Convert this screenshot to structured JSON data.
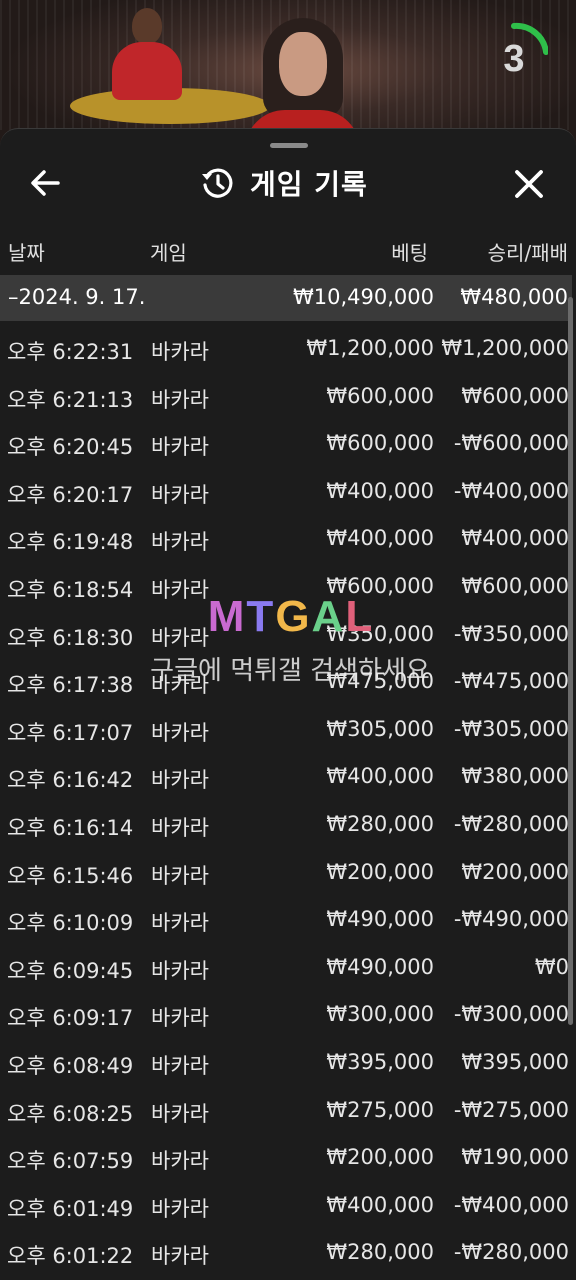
{
  "timer": {
    "value": "3",
    "progress_fraction": 0.3
  },
  "header": {
    "title": "게임 기록"
  },
  "columns": {
    "date": "날짜",
    "game": "게임",
    "bet": "베팅",
    "winloss": "승리/패배"
  },
  "summary": {
    "date": "–2024. 9. 17.",
    "bet": "₩10,490,000",
    "winloss": "₩480,000"
  },
  "rows": [
    {
      "time": "오후 6:22:31",
      "game": "바카라",
      "bet": "₩1,200,000",
      "winloss": "₩1,200,000"
    },
    {
      "time": "오후 6:21:13",
      "game": "바카라",
      "bet": "₩600,000",
      "winloss": "₩600,000"
    },
    {
      "time": "오후 6:20:45",
      "game": "바카라",
      "bet": "₩600,000",
      "winloss": "-₩600,000"
    },
    {
      "time": "오후 6:20:17",
      "game": "바카라",
      "bet": "₩400,000",
      "winloss": "-₩400,000"
    },
    {
      "time": "오후 6:19:48",
      "game": "바카라",
      "bet": "₩400,000",
      "winloss": "₩400,000"
    },
    {
      "time": "오후 6:18:54",
      "game": "바카라",
      "bet": "₩600,000",
      "winloss": "₩600,000"
    },
    {
      "time": "오후 6:18:30",
      "game": "바카라",
      "bet": "₩350,000",
      "winloss": "-₩350,000"
    },
    {
      "time": "오후 6:17:38",
      "game": "바카라",
      "bet": "₩475,000",
      "winloss": "-₩475,000"
    },
    {
      "time": "오후 6:17:07",
      "game": "바카라",
      "bet": "₩305,000",
      "winloss": "-₩305,000"
    },
    {
      "time": "오후 6:16:42",
      "game": "바카라",
      "bet": "₩400,000",
      "winloss": "₩380,000"
    },
    {
      "time": "오후 6:16:14",
      "game": "바카라",
      "bet": "₩280,000",
      "winloss": "-₩280,000"
    },
    {
      "time": "오후 6:15:46",
      "game": "바카라",
      "bet": "₩200,000",
      "winloss": "₩200,000"
    },
    {
      "time": "오후 6:10:09",
      "game": "바카라",
      "bet": "₩490,000",
      "winloss": "-₩490,000"
    },
    {
      "time": "오후 6:09:45",
      "game": "바카라",
      "bet": "₩490,000",
      "winloss": "₩0"
    },
    {
      "time": "오후 6:09:17",
      "game": "바카라",
      "bet": "₩300,000",
      "winloss": "-₩300,000"
    },
    {
      "time": "오후 6:08:49",
      "game": "바카라",
      "bet": "₩395,000",
      "winloss": "₩395,000"
    },
    {
      "time": "오후 6:08:25",
      "game": "바카라",
      "bet": "₩275,000",
      "winloss": "-₩275,000"
    },
    {
      "time": "오후 6:07:59",
      "game": "바카라",
      "bet": "₩200,000",
      "winloss": "₩190,000"
    },
    {
      "time": "오후 6:01:49",
      "game": "바카라",
      "bet": "₩400,000",
      "winloss": "-₩400,000"
    },
    {
      "time": "오후 6:01:22",
      "game": "바카라",
      "bet": "₩280,000",
      "winloss": "-₩280,000"
    }
  ],
  "watermark": {
    "logo": "MTGAL",
    "text": "구글에 먹튀갤 검색하세요"
  },
  "colors": {
    "panel_bg": "#1c1c1c",
    "summary_bg": "#3a3a3a",
    "timer_green": "#2fbf4a",
    "dealer_red": "#c0262a"
  }
}
